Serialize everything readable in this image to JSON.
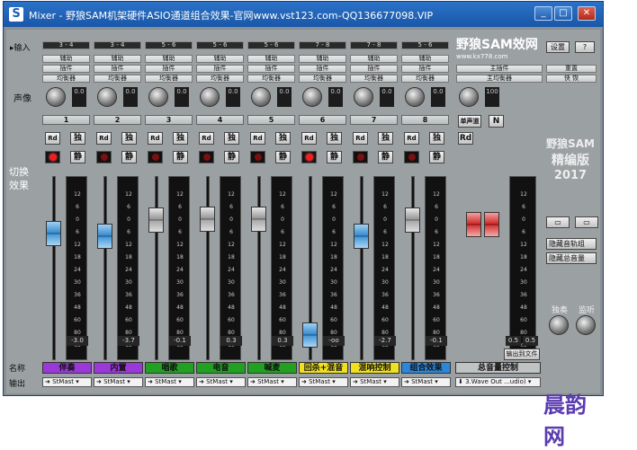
{
  "window": {
    "title": "Mixer - 野狼SAM机架硬件ASIO通道组合效果-官网www.vst123.com-QQ136677098.VIP",
    "icon": "S",
    "min": "_",
    "max": "□",
    "close": "✕"
  },
  "labels": {
    "input": "▸输入",
    "aux": "辅助",
    "plugin": "插件",
    "eq": "均衡器",
    "pan": "声像",
    "switch": "切换",
    "effect": "效果",
    "name": "名称",
    "output": "输出",
    "main_plugin": "主插件",
    "main_eq": "主均衡器",
    "setup": "设置",
    "help": "?",
    "reset": "重置",
    "fast": "快 恢",
    "hide_tracks": "隐藏音轨组",
    "hide_master": "隐藏总音量",
    "solo": "独奏",
    "monitor": "监听",
    "save_label": "单声道",
    "export_label": "输出到文件"
  },
  "logo": {
    "main": "野狼SAM效网",
    "url": "www.kx778.com"
  },
  "brand": {
    "line1": "野狼SAM",
    "line2": "精编版",
    "line3": "2017"
  },
  "watermark": "晨韵网",
  "channels": [
    {
      "num": "1",
      "input": "3 - 4",
      "pan": "0.0",
      "rec": true,
      "name": "伴奏",
      "name_color": "#9a38d8",
      "fader": "blue",
      "level": 0.72,
      "val": "-3.0",
      "out": "StMast"
    },
    {
      "num": "2",
      "input": "3 - 4",
      "pan": "0.0",
      "rec": false,
      "name": "内置",
      "name_color": "#9a38d8",
      "fader": "blue",
      "level": 0.7,
      "val": "-3.7",
      "out": "StMast"
    },
    {
      "num": "3",
      "input": "5 - 6",
      "pan": "0.0",
      "rec": false,
      "name": "唱歌",
      "name_color": "#22a022",
      "fader": "gray",
      "level": 0.8,
      "val": "-0.1",
      "out": "StMast"
    },
    {
      "num": "4",
      "input": "5 - 6",
      "pan": "0.0",
      "rec": false,
      "name": "电音",
      "name_color": "#22a022",
      "fader": "gray",
      "level": 0.81,
      "val": "0.3",
      "out": "StMast"
    },
    {
      "num": "5",
      "input": "5 - 6",
      "pan": "0.0",
      "rec": false,
      "name": "喊麦",
      "name_color": "#22a022",
      "fader": "gray",
      "level": 0.81,
      "val": "0.3",
      "out": "StMast"
    },
    {
      "num": "6",
      "input": "7 - 8",
      "pan": "0.0",
      "rec": true,
      "name": "回杀+混音",
      "name_color": "#f0e020",
      "fader": "blue",
      "level": 0.08,
      "val": "-oo",
      "out": "StMast"
    },
    {
      "num": "7",
      "input": "7 - 8",
      "pan": "0.0",
      "rec": false,
      "name": "混响控制",
      "name_color": "#f0e020",
      "fader": "blue",
      "level": 0.7,
      "val": "-2.7",
      "out": "StMast"
    },
    {
      "num": "8",
      "input": "5 - 6",
      "pan": "0.0",
      "rec": false,
      "name": "组合效果",
      "name_color": "#2d86d8",
      "fader": "gray",
      "level": 0.8,
      "val": "-0.1",
      "out": "StMast"
    }
  ],
  "master": {
    "name": "总音量控制",
    "pan": "100",
    "val_l": "0.5",
    "val_r": "0.5",
    "out": "3.Wave Out ...udio)",
    "rd": "Rd",
    "n": "N"
  },
  "scale": [
    "12",
    "6",
    "0",
    "6",
    "12",
    "18",
    "24",
    "30",
    "36",
    "48",
    "60",
    "80",
    "oo"
  ]
}
